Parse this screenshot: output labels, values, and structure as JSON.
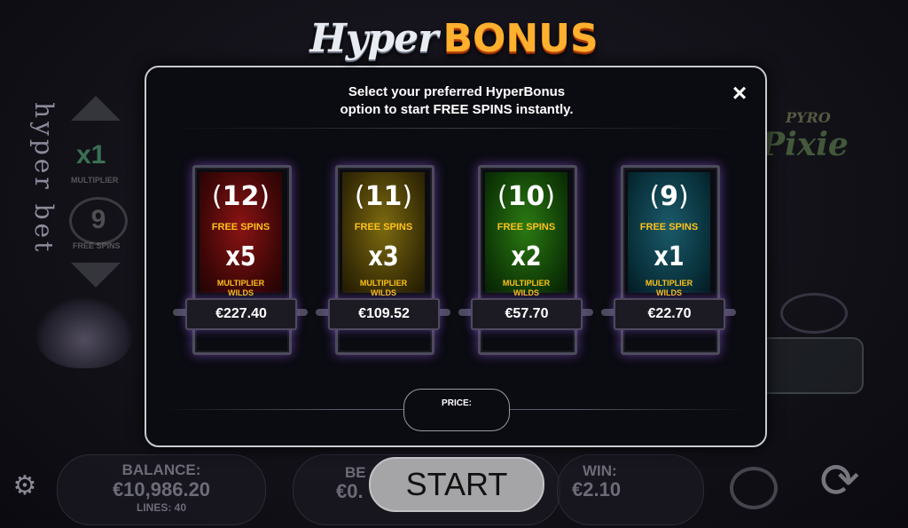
{
  "header": {
    "title_part1": "Hyper",
    "title_part2": "BONUS"
  },
  "modal": {
    "instructions_line1": "Select your preferred HyperBonus",
    "instructions_line2": "option to start FREE SPINS instantly.",
    "close_icon": "×",
    "price_label": "PRICE:"
  },
  "options": [
    {
      "free_spins": "12",
      "free_spins_label": "FREE SPINS",
      "multiplier": "x5",
      "multiplier_label_1": "MULTIPLIER",
      "multiplier_label_2": "WILDS",
      "price": "€227.40",
      "color": "#8a1414"
    },
    {
      "free_spins": "11",
      "free_spins_label": "FREE SPINS",
      "multiplier": "x3",
      "multiplier_label_1": "MULTIPLIER",
      "multiplier_label_2": "WILDS",
      "price": "€109.52",
      "color": "#7c6a10"
    },
    {
      "free_spins": "10",
      "free_spins_label": "FREE SPINS",
      "multiplier": "x2",
      "multiplier_label_1": "MULTIPLIER",
      "multiplier_label_2": "WILDS",
      "price": "€57.70",
      "color": "#2b7a12"
    },
    {
      "free_spins": "9",
      "free_spins_label": "FREE SPINS",
      "multiplier": "x1",
      "multiplier_label_1": "MULTIPLIER",
      "multiplier_label_2": "WILDS",
      "price": "€22.70",
      "color": "#1b5a6a"
    }
  ],
  "background": {
    "side_text": "hyper bet",
    "side_multiplier": "x1",
    "side_multiplier_label": "MULTIPLIER",
    "side_spins": "9",
    "side_spins_label": "FREE SPINS",
    "logo_line1": "PYRO",
    "logo_line2": "Pixie"
  },
  "footer": {
    "balance_label": "BALANCE:",
    "balance_value": "€10,986.20",
    "lines_label": "LINES: 40",
    "bet_label": "BE",
    "bet_value": "€0.",
    "start_label": "START",
    "win_label": "WIN:",
    "win_value": "€2.10",
    "settings_icon": "gear-icon",
    "autoplay_icon": "autoplay-icon",
    "spin_icon": "spin-icon"
  },
  "colors": {
    "accent_gold": "#ffc21a",
    "bonus_orange": "#ffb02e",
    "frame": "#4d4b5c"
  }
}
